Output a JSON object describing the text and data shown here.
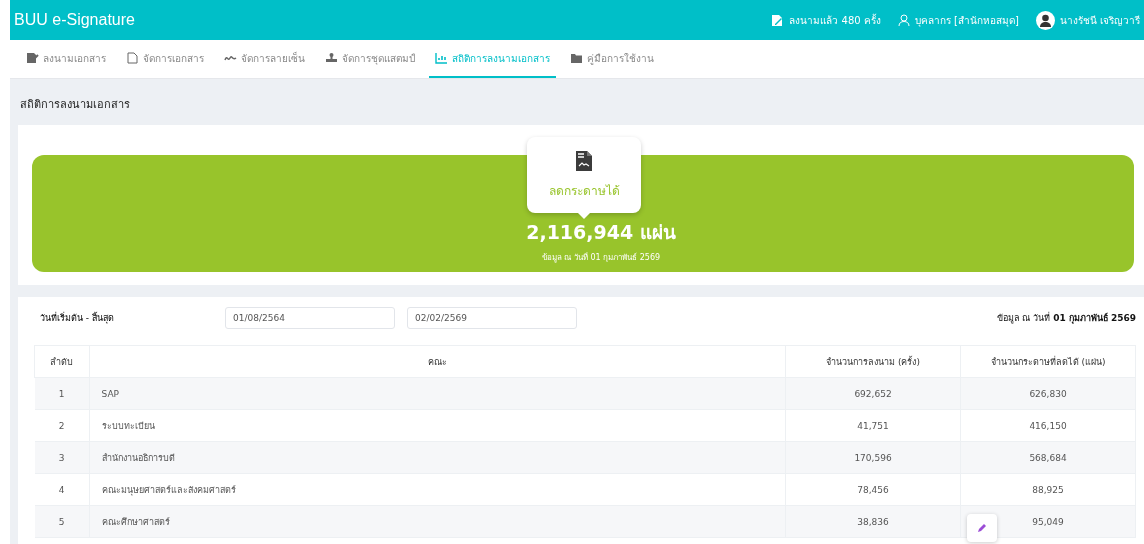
{
  "app": {
    "title": "BUU e-Signature",
    "signed_count": "ลงนามแล้ว 480 ครั้ง",
    "role": "บุคลากร [สำนักหอสมุด]",
    "user": "นางรัชนี เจริญวารี"
  },
  "tabs": [
    {
      "label": "ลงนามเอกสาร",
      "selected": false
    },
    {
      "label": "จัดการเอกสาร",
      "selected": false
    },
    {
      "label": "จัดการลายเซ็น",
      "selected": false
    },
    {
      "label": "จัดการชุดแสตมป์",
      "selected": false
    },
    {
      "label": "สถิติการลงนามเอกสาร",
      "selected": true
    },
    {
      "label": "คู่มือการใช้งาน",
      "selected": false
    }
  ],
  "page_title": "สถิติการลงนามเอกสาร",
  "summary": {
    "label": "ลดกระดาษได้",
    "total": "2,116,944 แผ่น",
    "as_of": "ข้อมูล ณ วันที่ 01 กุมภาพันธ์ 2569"
  },
  "filter": {
    "label": "วันที่เริ่มต้น - สิ้นสุด",
    "start": "01/08/2564",
    "end": "02/02/2569",
    "as_of_prefix": "ข้อมูล ณ วันที่",
    "as_of_date": "01 กุมภาพันธ์ 2569"
  },
  "table": {
    "columns": [
      "ลำดับ",
      "คณะ",
      "จำนวนการลงนาม (ครั้ง)",
      "จำนวนกระดาษที่ลดได้ (แผ่น)"
    ],
    "rows": [
      [
        "1",
        "SAP",
        "692,652",
        "626,830"
      ],
      [
        "2",
        "ระบบทะเบียน",
        "41,751",
        "416,150"
      ],
      [
        "3",
        "สำนักงานอธิการบดี",
        "170,596",
        "568,684"
      ],
      [
        "4",
        "คณะมนุษยศาสตร์และสังคมศาสตร์",
        "78,456",
        "88,925"
      ],
      [
        "5",
        "คณะศึกษาศาสตร์",
        "38,836",
        "95,049"
      ]
    ]
  }
}
